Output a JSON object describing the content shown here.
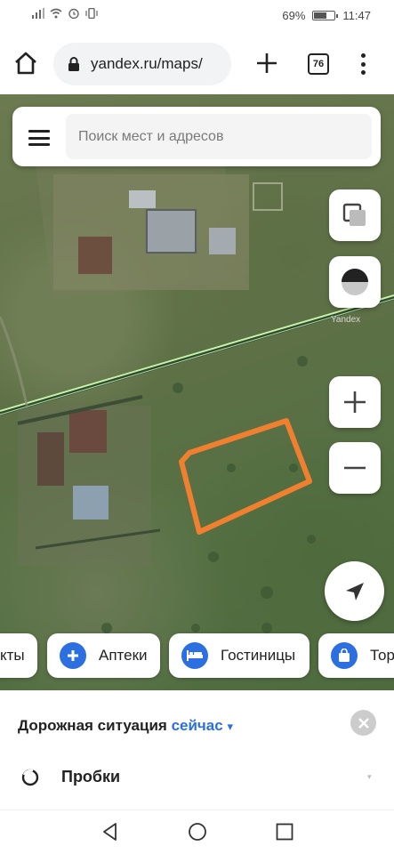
{
  "status_bar": {
    "signal": "signal-icon",
    "wifi": "wifi-icon",
    "alarm": "alarm-icon",
    "vibrate": "vibrate-icon",
    "battery_percent": "69%",
    "time": "11:47"
  },
  "browser": {
    "url": "yandex.ru/maps/",
    "tab_count": "76",
    "home_icon": "home-icon",
    "lock_icon": "lock-icon",
    "new_tab_icon": "plus-icon",
    "menu_icon": "more-vert-icon"
  },
  "search": {
    "placeholder": "Поиск мест и адресов"
  },
  "map": {
    "watermark": "Yandex"
  },
  "chips": [
    {
      "label": "кты",
      "icon": ""
    },
    {
      "label": "Аптеки",
      "icon": "plus-icon"
    },
    {
      "label": "Гостиницы",
      "icon": "bed-icon"
    },
    {
      "label": "Тор",
      "icon": "shopping-bag-icon"
    }
  ],
  "traffic": {
    "title": "Дорожная ситуация",
    "now": "сейчас",
    "dropdown": "▾",
    "label": "Пробки",
    "chevron": "▾"
  },
  "colors": {
    "accent": "#2b6fe0",
    "outline": "#f08030",
    "road": "#c9f2a8"
  }
}
